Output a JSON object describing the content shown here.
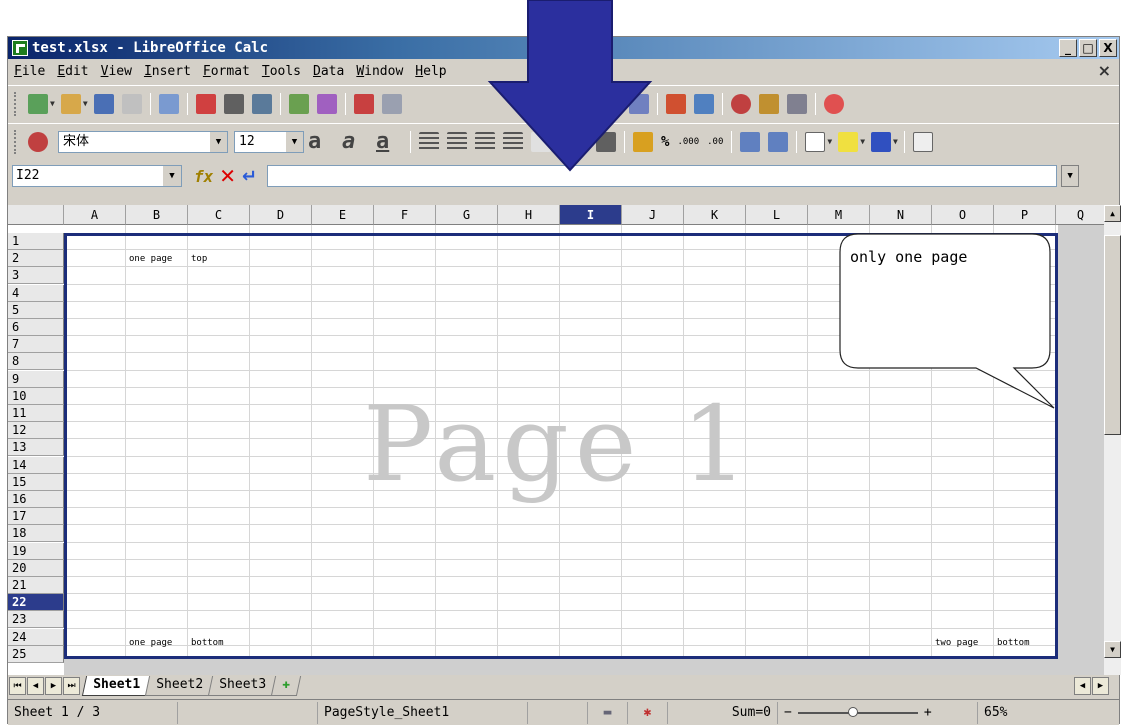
{
  "window": {
    "title": "test.xlsx - LibreOffice Calc",
    "buttons": [
      "_",
      "□",
      "X"
    ]
  },
  "menubar": {
    "items": [
      "File",
      "Edit",
      "View",
      "Insert",
      "Format",
      "Tools",
      "Data",
      "Window",
      "Help"
    ],
    "close": "×"
  },
  "format_toolbar": {
    "font_name": "宋体",
    "font_size": "12",
    "currency": "%",
    "decimal_add": ".000",
    "decimal_remove": ".00"
  },
  "formula_bar": {
    "name_box": "I22",
    "fx": "fx",
    "cancel": "✕",
    "accept": "↵",
    "content": ""
  },
  "columns": [
    "A",
    "B",
    "C",
    "D",
    "E",
    "F",
    "G",
    "H",
    "I",
    "J",
    "K",
    "L",
    "M",
    "N",
    "O",
    "P",
    "Q"
  ],
  "selected_column": "I",
  "rows": [
    "1",
    "2",
    "3",
    "4",
    "5",
    "6",
    "7",
    "8",
    "9",
    "10",
    "11",
    "12",
    "13",
    "14",
    "15",
    "16",
    "17",
    "18",
    "19",
    "20",
    "21",
    "22",
    "23",
    "24",
    "25"
  ],
  "selected_row": "22",
  "cells": {
    "b3": "one page",
    "c3": "top",
    "b24": "one page",
    "c24": "bottom",
    "o24": "two page",
    "p24": "bottom"
  },
  "watermark": "Page 1",
  "callout": {
    "text": "only one page"
  },
  "sheet_tabs": [
    "Sheet1",
    "Sheet2",
    "Sheet3"
  ],
  "active_tab": "Sheet1",
  "status": {
    "sheet": "Sheet 1 / 3",
    "page_style": "PageStyle_Sheet1",
    "sum": "Sum=0",
    "zoom": "65%"
  },
  "colors": {
    "page_border": "#1c2d7a",
    "selected_header": "#2c3c8c",
    "arrow": "#2b2f9e"
  }
}
